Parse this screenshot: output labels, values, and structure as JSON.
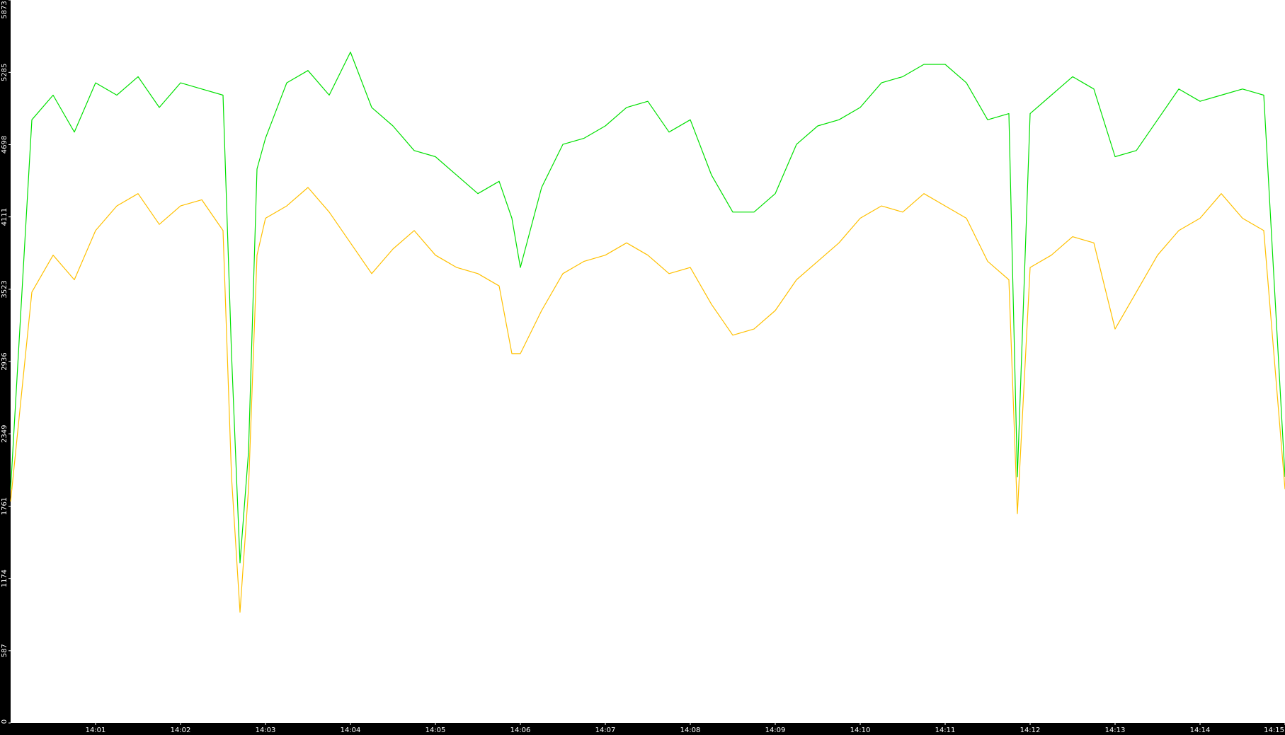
{
  "chart_data": {
    "type": "line",
    "title": "",
    "xlabel": "",
    "ylabel": "",
    "ylim": [
      0,
      5873
    ],
    "y_ticks": [
      "0",
      "587",
      "1174",
      "1761",
      "2349",
      "2936",
      "3523",
      "4111",
      "4698",
      "5285",
      "5873"
    ],
    "x_ticks": [
      "14:01",
      "14:02",
      "14:03",
      "14:04",
      "14:05",
      "14:06",
      "14:07",
      "14:08",
      "14:09",
      "14:10",
      "14:11",
      "14:12",
      "14:13",
      "14:14",
      "14:15"
    ],
    "xlim_minutes": [
      0,
      15
    ],
    "x_tick_positions_minutes": [
      1,
      2,
      3,
      4,
      5,
      6,
      7,
      8,
      9,
      10,
      11,
      12,
      13,
      14,
      15
    ],
    "background": "#ffffff",
    "axis_background": "#000000",
    "grid": false,
    "legend": "none",
    "series": [
      {
        "color": "#00e000",
        "x_minutes": [
          0.0,
          0.25,
          0.5,
          0.75,
          1.0,
          1.25,
          1.5,
          1.75,
          2.0,
          2.25,
          2.5,
          2.6,
          2.7,
          2.8,
          2.9,
          3.0,
          3.25,
          3.5,
          3.75,
          4.0,
          4.25,
          4.5,
          4.75,
          5.0,
          5.25,
          5.5,
          5.75,
          5.9,
          6.0,
          6.25,
          6.5,
          6.75,
          7.0,
          7.25,
          7.5,
          7.75,
          8.0,
          8.25,
          8.5,
          8.75,
          9.0,
          9.25,
          9.5,
          9.75,
          10.0,
          10.25,
          10.5,
          10.75,
          11.0,
          11.25,
          11.5,
          11.75,
          11.85,
          12.0,
          12.25,
          12.5,
          12.75,
          13.0,
          13.25,
          13.5,
          13.75,
          14.0,
          14.25,
          14.5,
          14.75,
          15.0
        ],
        "values": [
          1900,
          4900,
          5100,
          4800,
          5200,
          5100,
          5250,
          5000,
          5200,
          5150,
          5100,
          3000,
          1300,
          2200,
          4500,
          4750,
          5200,
          5300,
          5100,
          5450,
          5000,
          4850,
          4650,
          4600,
          4450,
          4300,
          4400,
          4100,
          3700,
          4350,
          4700,
          4750,
          4850,
          5000,
          5050,
          4800,
          4900,
          4450,
          4150,
          4150,
          4300,
          4700,
          4850,
          4900,
          5000,
          5200,
          5250,
          5350,
          5350,
          5200,
          4900,
          4950,
          2000,
          4950,
          5100,
          5250,
          5150,
          4600,
          4650,
          4900,
          5150,
          5050,
          5100,
          5150,
          5100,
          2000
        ]
      },
      {
        "color": "#ffc000",
        "x_minutes": [
          0.0,
          0.25,
          0.5,
          0.75,
          1.0,
          1.25,
          1.5,
          1.75,
          2.0,
          2.25,
          2.5,
          2.6,
          2.7,
          2.8,
          2.9,
          3.0,
          3.25,
          3.5,
          3.75,
          4.0,
          4.25,
          4.5,
          4.75,
          5.0,
          5.25,
          5.5,
          5.75,
          5.9,
          6.0,
          6.25,
          6.5,
          6.75,
          7.0,
          7.25,
          7.5,
          7.75,
          8.0,
          8.25,
          8.5,
          8.75,
          9.0,
          9.25,
          9.5,
          9.75,
          10.0,
          10.25,
          10.5,
          10.75,
          11.0,
          11.25,
          11.5,
          11.75,
          11.85,
          12.0,
          12.25,
          12.5,
          12.75,
          13.0,
          13.25,
          13.5,
          13.75,
          14.0,
          14.25,
          14.5,
          14.75,
          15.0
        ],
        "values": [
          1800,
          3500,
          3800,
          3600,
          4000,
          4200,
          4300,
          4050,
          4200,
          4250,
          4000,
          2000,
          900,
          1900,
          3800,
          4100,
          4200,
          4350,
          4150,
          3900,
          3650,
          3850,
          4000,
          3800,
          3700,
          3650,
          3550,
          3000,
          3000,
          3350,
          3650,
          3750,
          3800,
          3900,
          3800,
          3650,
          3700,
          3400,
          3150,
          3200,
          3350,
          3600,
          3750,
          3900,
          4100,
          4200,
          4150,
          4300,
          4200,
          4100,
          3750,
          3600,
          1700,
          3700,
          3800,
          3950,
          3900,
          3200,
          3500,
          3800,
          4000,
          4100,
          4300,
          4100,
          4000,
          1900
        ]
      }
    ]
  }
}
